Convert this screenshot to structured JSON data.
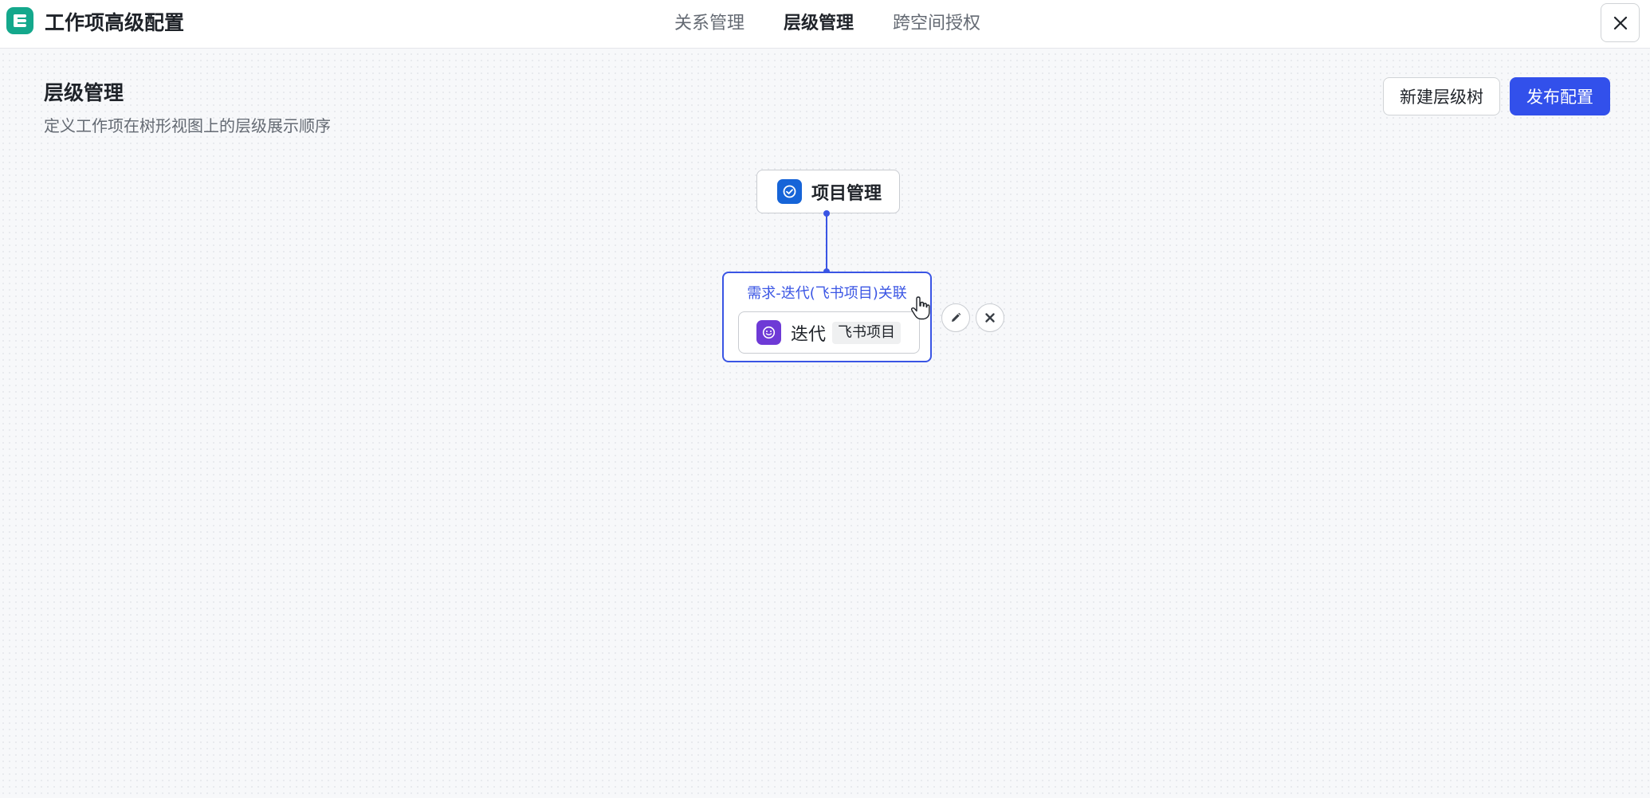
{
  "header": {
    "app_title": "工作项高级配置",
    "tabs": [
      {
        "label": "关系管理",
        "active": false
      },
      {
        "label": "层级管理",
        "active": true
      },
      {
        "label": "跨空间授权",
        "active": false
      }
    ],
    "logo_icon": "app-logo-icon",
    "close_icon": "close-icon"
  },
  "page": {
    "title": "层级管理",
    "subtitle": "定义工作项在树形视图上的层级展示顺序",
    "new_tree_label": "新建层级树",
    "publish_label": "发布配置"
  },
  "tree": {
    "root": {
      "label": "项目管理",
      "icon": "check-circle-icon"
    },
    "relation": {
      "label": "需求-迭代(飞书项目)关联",
      "child": {
        "label": "迭代",
        "tag": "飞书项目",
        "icon": "smile-icon"
      }
    }
  },
  "colors": {
    "accent": "#3250eb",
    "logo": "#14a88c",
    "root_icon": "#1664d8",
    "child_icon": "#6e3ad6"
  }
}
